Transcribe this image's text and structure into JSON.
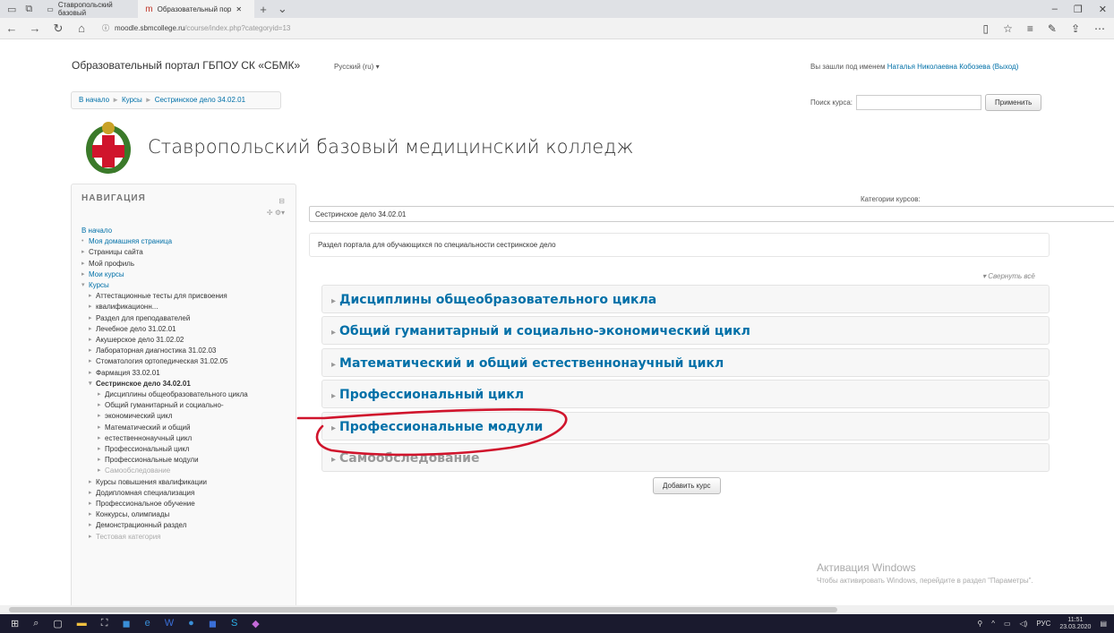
{
  "browser": {
    "tabs": [
      {
        "title": "Ставропольский базовый"
      },
      {
        "title": "Образовательный пор"
      }
    ],
    "url_host": "moodle.sbmcollege.ru",
    "url_path": "/course/index.php?categoryid=13"
  },
  "header": {
    "site_title": "Образовательный портал ГБПОУ СК «СБМК»",
    "language": "Русский (ru) ▾",
    "login_prefix": "Вы зашли под именем",
    "user_name": "Наталья Николаевна Кобозева",
    "logout": "(Выход)"
  },
  "breadcrumb": [
    "В начало",
    "Курсы",
    "Сестринское дело 34.02.01"
  ],
  "search": {
    "label": "Поиск курса:",
    "button": "Применить"
  },
  "college_name": "Ставропольский базовый медицинский колледж",
  "navigation": {
    "title": "НАВИГАЦИЯ",
    "items": [
      "В начало",
      "Моя домашняя страница",
      "Страницы сайта",
      "Мой профиль",
      "Мои курсы",
      "Курсы",
      "Аттестационные тесты для присвоения",
      "квалификационн...",
      "Раздел для преподавателей",
      "Лечебное дело 31.02.01",
      "Акушерское дело 31.02.02",
      "Лабораторная диагностика 31.02.03",
      "Стоматология ортопедическая 31.02.05",
      "Фармация 33.02.01",
      "Сестринское дело 34.02.01",
      "Дисциплины общеобразовательного цикла",
      "Общий гуманитарный и социально-",
      "экономический цикл",
      "Математический и общий",
      "естественнонаучный цикл",
      "Профессиональный цикл",
      "Профессиональные модули",
      "Самообследование",
      "Курсы повышения квалификации",
      "Додипломная специализация",
      "Профессиональное обучение",
      "Конкурсы, олимпиады",
      "Демонстрационный раздел",
      "Тестовая категория"
    ]
  },
  "main": {
    "categories_label": "Категории курсов:",
    "selected_category": "Сестринское дело 34.02.01",
    "description": "Раздел портала для обучающихся по специальности сестринское дело",
    "collapse_all": "Свернуть всё",
    "categories": [
      "Дисциплины общеобразовательного цикла",
      "Общий гуманитарный и социально-экономический цикл",
      "Математический и общий естественнонаучный цикл",
      "Профессиональный цикл",
      "Профессиональные модули",
      "Самообследование"
    ],
    "add_course": "Добавить курс"
  },
  "watermark": {
    "title": "Активация Windows",
    "subtitle": "Чтобы активировать Windows, перейдите в раздел \"Параметры\"."
  },
  "taskbar": {
    "lang": "РУС",
    "time": "11:51",
    "date": "23.03.2020"
  },
  "colors": {
    "link": "#0070a8",
    "annotation": "#d0142c"
  }
}
